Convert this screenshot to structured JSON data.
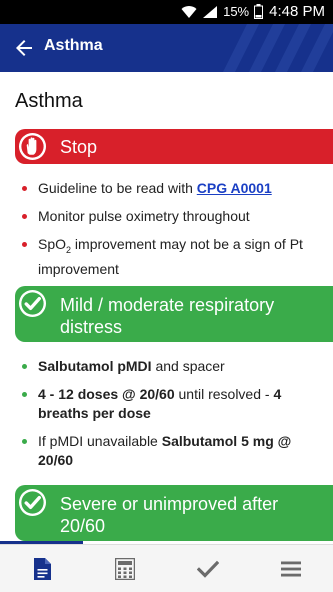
{
  "status_bar": {
    "battery": "15%",
    "time": "4:48 PM"
  },
  "app_bar": {
    "title": "Asthma"
  },
  "page": {
    "title": "Asthma"
  },
  "stop_section": {
    "label": "Stop",
    "items": [
      {
        "text": "Guideline to be read with ",
        "link": "CPG A0001"
      },
      {
        "text": "Monitor pulse oximetry throughout"
      },
      {
        "pre": "SpO",
        "sub": "2",
        "post": " improvement may not be a sign of Pt improvement"
      }
    ]
  },
  "mild_section": {
    "label": "Mild / moderate respiratory distress",
    "items": [
      {
        "bold": "Salbutamol pMDI",
        "text": " and spacer"
      },
      {
        "bold": "4 - 12 doses @ 20/60",
        "text": " until resolved - ",
        "bold2": "4 breaths per dose"
      },
      {
        "text": "If pMDI unavailable ",
        "bold": "Salbutamol 5 mg @ 20/60"
      }
    ]
  },
  "severe_section": {
    "label": "Severe or unimproved after 20/60"
  },
  "bottom_nav": [
    {
      "icon": "document-icon",
      "active": true
    },
    {
      "icon": "calculator-icon",
      "active": false
    },
    {
      "icon": "checkmark-icon",
      "active": false
    },
    {
      "icon": "menu-icon",
      "active": false
    }
  ],
  "colors": {
    "app_bar": "#16318c",
    "stop": "#d8202a",
    "green": "#3aab4a",
    "link": "#1a3fc4"
  }
}
